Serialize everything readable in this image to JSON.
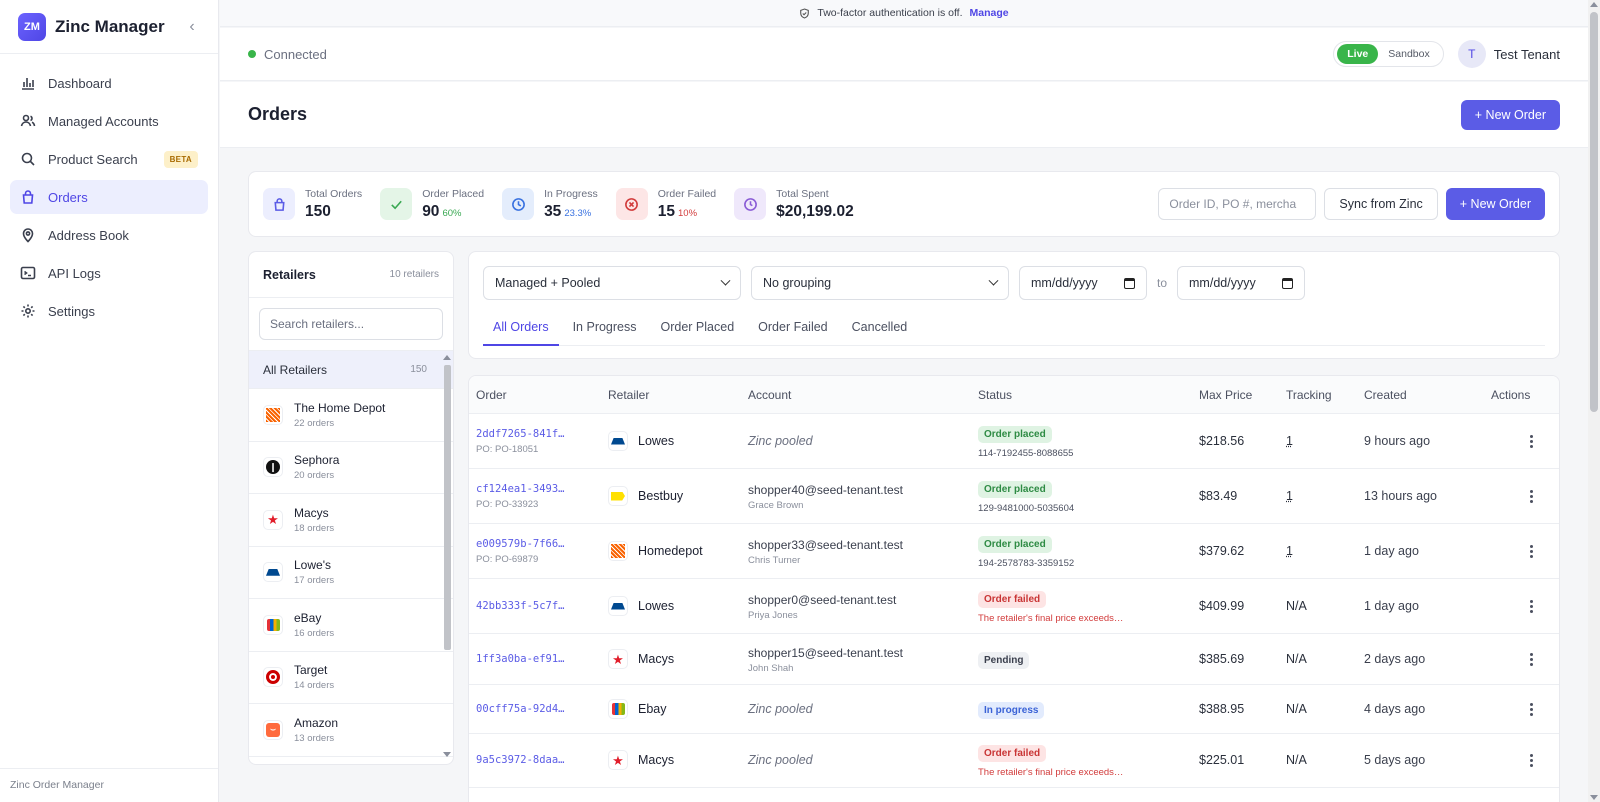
{
  "brand": {
    "logo_text": "ZM",
    "name": "Zinc Manager"
  },
  "nav": [
    {
      "label": "Dashboard",
      "icon": "chart-icon"
    },
    {
      "label": "Managed Accounts",
      "icon": "users-icon"
    },
    {
      "label": "Product Search",
      "icon": "search-icon",
      "badge": "BETA"
    },
    {
      "label": "Orders",
      "icon": "bag-icon",
      "active": true
    },
    {
      "label": "Address Book",
      "icon": "map-pin-icon"
    },
    {
      "label": "API Logs",
      "icon": "terminal-icon"
    },
    {
      "label": "Settings",
      "icon": "gear-icon"
    }
  ],
  "sidebar_footer": "Zinc Order Manager",
  "banner": {
    "text": "Two-factor authentication is off.",
    "link": "Manage"
  },
  "header": {
    "connection": "Connected",
    "env_live": "Live",
    "env_sandbox": "Sandbox",
    "avatar_initial": "T",
    "user_name": "Test Tenant"
  },
  "page": {
    "title": "Orders",
    "new_order_label": "+ New Order"
  },
  "stats": [
    {
      "label": "Total Orders",
      "value": "150",
      "sub": "",
      "icon": "bag-icon",
      "color": "#5b5ce6",
      "bg": "#eceefe"
    },
    {
      "label": "Order Placed",
      "value": "90",
      "sub": "60%",
      "icon": "check-icon",
      "color": "#39a852",
      "bg": "#e4f5e7",
      "sub_color": "#39a852"
    },
    {
      "label": "In Progress",
      "value": "35",
      "sub": "23.3%",
      "icon": "clock-icon",
      "color": "#3a72e0",
      "bg": "#e4edfc",
      "sub_color": "#3a72e0"
    },
    {
      "label": "Order Failed",
      "value": "15",
      "sub": "10%",
      "icon": "x-circle-icon",
      "color": "#d23c3c",
      "bg": "#fde6e6",
      "sub_color": "#d23c3c"
    },
    {
      "label": "Total Spent",
      "value": "$20,199.02",
      "sub": "",
      "icon": "dollar-icon",
      "color": "#8a5cd6",
      "bg": "#efe8fb"
    }
  ],
  "stats_actions": {
    "search_placeholder": "Order ID, PO #, mercha",
    "sync_label": "Sync from Zinc",
    "new_order_label": "+ New Order"
  },
  "retailers_panel": {
    "title": "Retailers",
    "count": "10 retailers",
    "search_placeholder": "Search retailers...",
    "all_label": "All Retailers",
    "all_count": "150",
    "items": [
      {
        "name": "The Home Depot",
        "orders": "22 orders",
        "logo": "homedepot"
      },
      {
        "name": "Sephora",
        "orders": "20 orders",
        "logo": "sephora"
      },
      {
        "name": "Macys",
        "orders": "18 orders",
        "logo": "macys"
      },
      {
        "name": "Lowe's",
        "orders": "17 orders",
        "logo": "lowes"
      },
      {
        "name": "eBay",
        "orders": "16 orders",
        "logo": "ebay"
      },
      {
        "name": "Target",
        "orders": "14 orders",
        "logo": "target"
      },
      {
        "name": "Amazon",
        "orders": "13 orders",
        "logo": "amazon"
      }
    ]
  },
  "filters": {
    "account_scope": "Managed + Pooled",
    "grouping": "No grouping",
    "date_from": "mm/dd/yyyy",
    "date_to": "mm/dd/yyyy",
    "to_label": "to",
    "tabs": [
      "All Orders",
      "In Progress",
      "Order Placed",
      "Order Failed",
      "Cancelled"
    ],
    "active_tab": 0
  },
  "table": {
    "columns": [
      "Order",
      "Retailer",
      "Account",
      "Status",
      "Max Price",
      "Tracking",
      "Created",
      "Actions"
    ],
    "rows": [
      {
        "id": "2ddf7265-841f…",
        "po": "PO: PO-18051",
        "retailer": "Lowes",
        "logo": "lowes",
        "account_email": "",
        "account_name": "",
        "pooled": "Zinc pooled",
        "status": "Order placed",
        "status_type": "placed",
        "status_sub": "114-7192455-8088655",
        "price": "$218.56",
        "tracking": "1",
        "created": "9 hours ago"
      },
      {
        "id": "cf124ea1-3493…",
        "po": "PO: PO-33923",
        "retailer": "Bestbuy",
        "logo": "bestbuy",
        "account_email": "shopper40@seed-tenant.test",
        "account_name": "Grace Brown",
        "pooled": "",
        "status": "Order placed",
        "status_type": "placed",
        "status_sub": "129-9481000-5035604",
        "price": "$83.49",
        "tracking": "1",
        "created": "13 hours ago"
      },
      {
        "id": "e009579b-7f66…",
        "po": "PO: PO-69879",
        "retailer": "Homedepot",
        "logo": "homedepot",
        "account_email": "shopper33@seed-tenant.test",
        "account_name": "Chris Turner",
        "pooled": "",
        "status": "Order placed",
        "status_type": "placed",
        "status_sub": "194-2578783-3359152",
        "price": "$379.62",
        "tracking": "1",
        "created": "1 day ago"
      },
      {
        "id": "42bb333f-5c7f…",
        "po": "",
        "retailer": "Lowes",
        "logo": "lowes",
        "account_email": "shopper0@seed-tenant.test",
        "account_name": "Priya Jones",
        "pooled": "",
        "status": "Order failed",
        "status_type": "failed",
        "status_sub": "The retailer's final price exceeds…",
        "price": "$409.99",
        "tracking": "N/A",
        "created": "1 day ago"
      },
      {
        "id": "1ff3a0ba-ef91…",
        "po": "",
        "retailer": "Macys",
        "logo": "macys",
        "account_email": "shopper15@seed-tenant.test",
        "account_name": "John Shah",
        "pooled": "",
        "status": "Pending",
        "status_type": "pending",
        "status_sub": "",
        "price": "$385.69",
        "tracking": "N/A",
        "created": "2 days ago"
      },
      {
        "id": "00cff75a-92d4…",
        "po": "",
        "retailer": "Ebay",
        "logo": "ebay",
        "account_email": "",
        "account_name": "",
        "pooled": "Zinc pooled",
        "status": "In progress",
        "status_type": "progress",
        "status_sub": "",
        "price": "$388.95",
        "tracking": "N/A",
        "created": "4 days ago"
      },
      {
        "id": "9a5c3972-8daa…",
        "po": "",
        "retailer": "Macys",
        "logo": "macys",
        "account_email": "",
        "account_name": "",
        "pooled": "Zinc pooled",
        "status": "Order failed",
        "status_type": "failed",
        "status_sub": "The retailer's final price exceeds…",
        "price": "$225.01",
        "tracking": "N/A",
        "created": "5 days ago"
      }
    ]
  }
}
